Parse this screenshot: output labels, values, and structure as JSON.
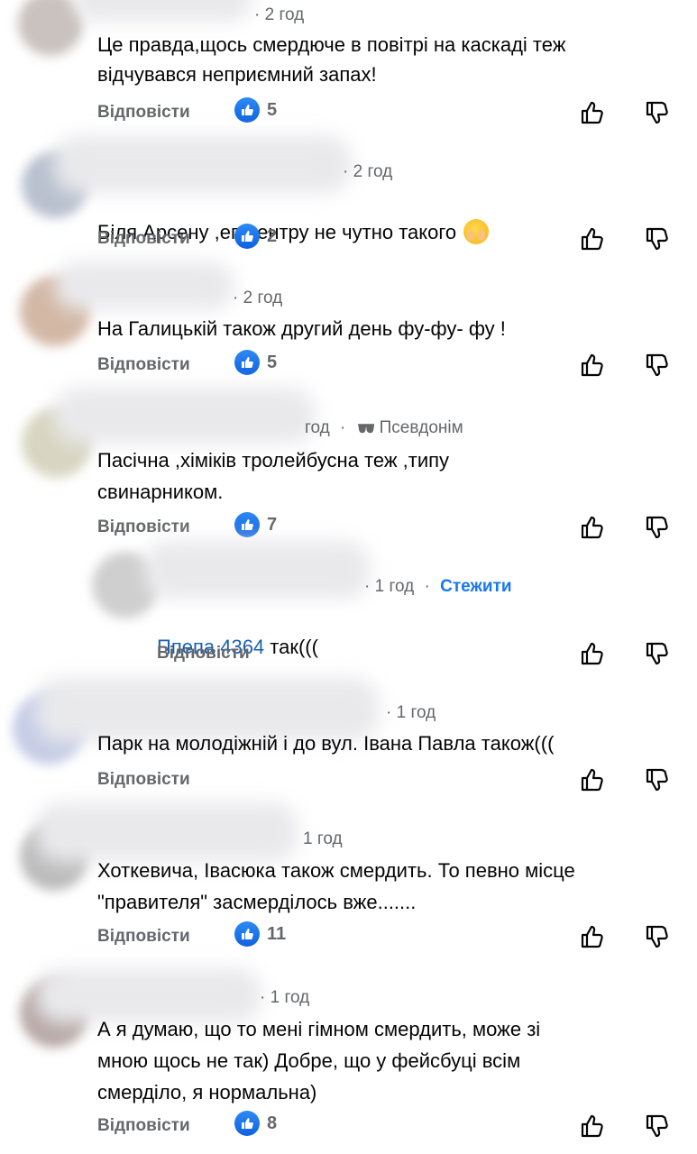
{
  "comments": [
    {
      "time": "2 год",
      "text": "Це правда,щось смердюче в повітрі на каскаді теж\nвідчувався неприємний запах!",
      "reply": "Відповісти",
      "likes": "5"
    },
    {
      "time": "2 год",
      "text": "Біля Арсену ,епіцентру не чутно такого",
      "emoji": "face-with-hands-over-mouth",
      "reply": "Відповісти",
      "likes": "2"
    },
    {
      "time": "2 год",
      "text": "На Галицькій також другий день фу-фу- фу !",
      "reply": "Відповісти",
      "likes": "5"
    },
    {
      "time": "год",
      "badge": "Псевдонім",
      "text": "Пасічна ,хіміків тролейбусна теж ,типу\nсвинарником.",
      "reply": "Відповісти",
      "likes": "7"
    },
    {
      "time": "1 год",
      "follow": "Стежити",
      "mention": "Ппепа 4364",
      "text": " так(((",
      "reply": "Відповісти"
    },
    {
      "time": "1 год",
      "text": "Парк на молодіжній і до вул. Івана Павла також(((",
      "reply": "Відповісти"
    },
    {
      "time": "1 год",
      "text": "Хоткевича, Івасюка також смердить. То певно місце\n\"правителя\" засмерділось вже.......",
      "reply": "Відповісти",
      "likes": "11"
    },
    {
      "time": "1 год",
      "text": "А я думаю, що то мені гімном смердить, може зі\nмною щось не так) Добре, що у фейсбуці всім\nсмерділо, я нормальна)",
      "reply": "Відповісти",
      "likes": "8"
    }
  ],
  "icons": {
    "like": "like-thumb-icon",
    "upvote": "thumb-up-outline-icon",
    "downvote": "thumb-down-outline-icon",
    "anon": "sunglasses-icon"
  },
  "colors": {
    "accent": "#1877f2",
    "secondary_text": "#65676b"
  }
}
